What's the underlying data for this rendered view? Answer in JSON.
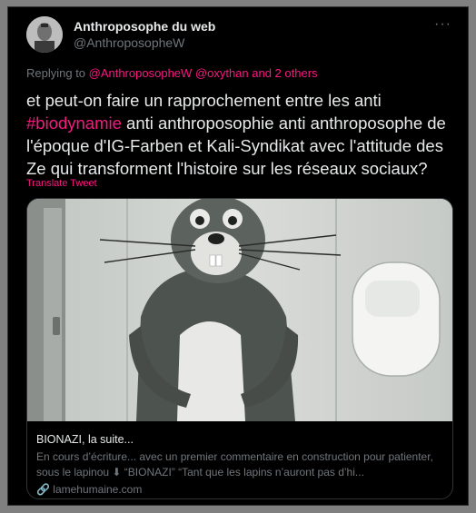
{
  "author": {
    "name": "Anthroposophe du web",
    "handle": "@AnthroposopheW"
  },
  "more_label": "···",
  "replying": {
    "prefix": "Replying to ",
    "users": "@AnthroposopheW @oxythan and 2 others"
  },
  "tweet": {
    "part1": "et peut-on faire un rapprochement entre les anti ",
    "hashtag": "#biodynamie",
    "part2": " anti anthroposophie anti anthroposophe de l'époque d'IG-Farben et Kali-Syndikat avec l'attitude des Ze qui transforment l'histoire sur les réseaux sociaux?"
  },
  "translate_label": "Translate Tweet",
  "card": {
    "title": "BIONAZI, la suite...",
    "description": "En cours d’écriture... avec un premier commentaire en construction pour patienter, sous le lapinou ⬇ “BIONAZI” “Tant que les lapins n’auront pas d’hi...",
    "domain": "lamehumaine.com",
    "domain_icon": "🔗"
  },
  "colors": {
    "background": "#000000",
    "text": "#e7e9ea",
    "muted": "#71767b",
    "accent": "#f91880",
    "border": "#2f3336"
  }
}
